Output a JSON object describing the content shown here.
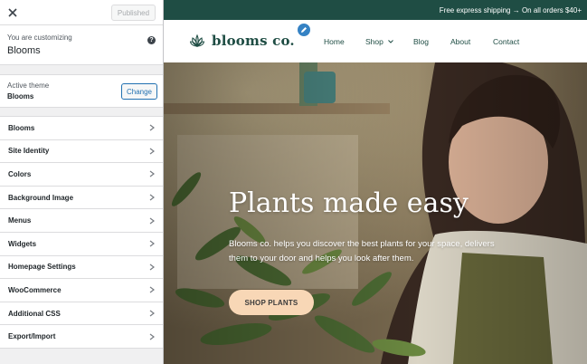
{
  "customizer": {
    "published_label": "Published",
    "customizing_label": "You are customizing",
    "site_name": "Blooms",
    "active_theme_label": "Active theme",
    "theme_name": "Blooms",
    "change_label": "Change",
    "menu": [
      {
        "label": "Blooms"
      },
      {
        "label": "Site Identity"
      },
      {
        "label": "Colors"
      },
      {
        "label": "Background Image"
      },
      {
        "label": "Menus"
      },
      {
        "label": "Widgets"
      },
      {
        "label": "Homepage Settings"
      },
      {
        "label": "WooCommerce"
      },
      {
        "label": "Additional CSS"
      },
      {
        "label": "Export/Import"
      }
    ]
  },
  "preview": {
    "topbar_text": "Free express shipping → On all orders $40+",
    "brand": "blooms co.",
    "nav": {
      "home": "Home",
      "shop": "Shop",
      "blog": "Blog",
      "about": "About",
      "contact": "Contact"
    },
    "hero": {
      "title": "Plants made easy",
      "text": "Blooms co. helps you discover the best plants for your space, delivers them to your door and helps you look after them.",
      "button": "SHOP PLANTS"
    }
  },
  "colors": {
    "brand_green": "#1f4d44",
    "button_peach": "#f8d7b6",
    "wp_blue": "#2271b1"
  },
  "icons": [
    "close-icon",
    "help-icon",
    "chevron-right-icon",
    "flower-logo-icon",
    "pencil-icon",
    "chevron-down-icon"
  ]
}
